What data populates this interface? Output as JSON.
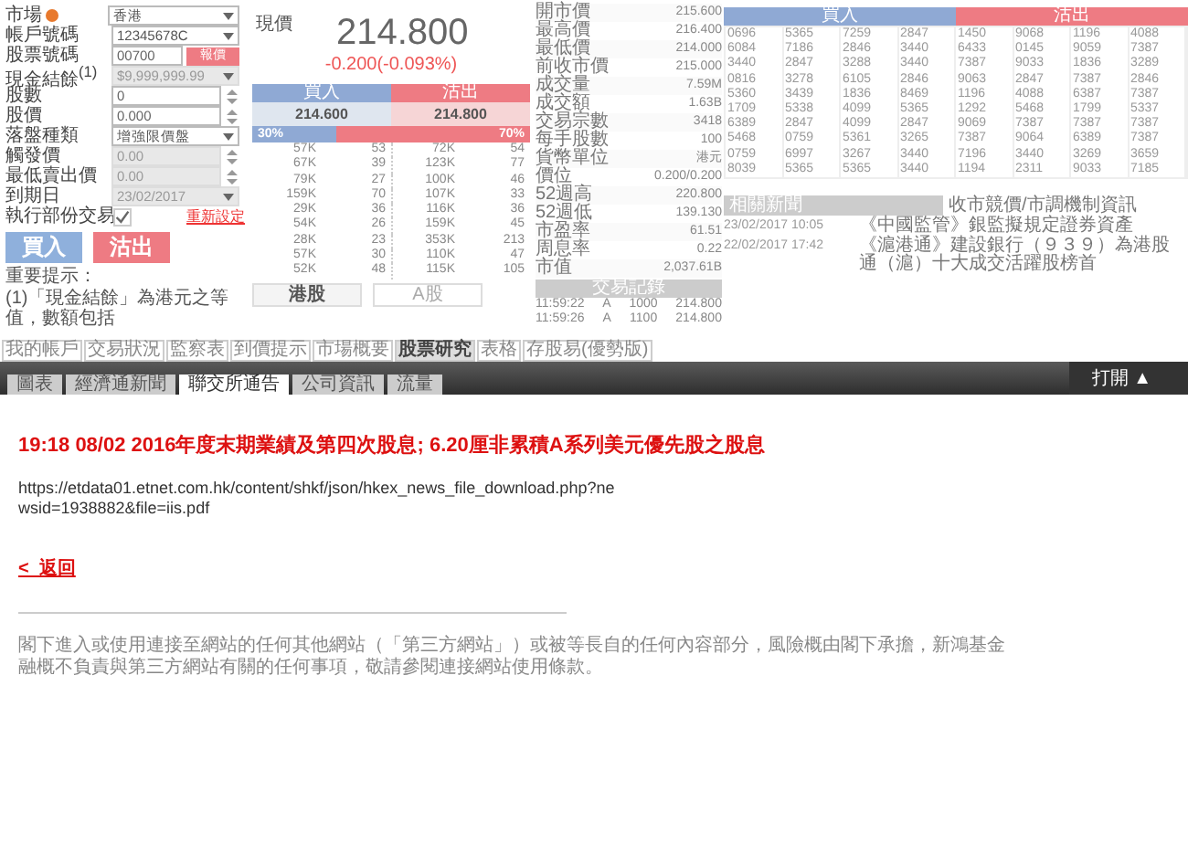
{
  "order_form": {
    "fields": [
      {
        "label": "市場",
        "kind": "select",
        "value": "香港",
        "disabled": false,
        "info": true
      },
      {
        "label": "帳戶號碼",
        "kind": "select",
        "value": "12345678C",
        "disabled": false,
        "info": false
      },
      {
        "label": "股票號碼",
        "kind": "quote",
        "value": "00700",
        "button": "報價",
        "disabled": false,
        "info": false
      },
      {
        "label": "現金結餘$^{(1)}$",
        "kind": "select",
        "value": "$9,999,999.99",
        "disabled": true,
        "info": false
      },
      {
        "label": "股數",
        "kind": "spinner",
        "value": "0",
        "disabled": false,
        "info": false
      },
      {
        "label": "股價",
        "kind": "spinner",
        "value": "0.000",
        "disabled": false,
        "info": false
      },
      {
        "label": "落盤種類",
        "kind": "select",
        "value": "增強限價盤",
        "disabled": false,
        "info": false
      },
      {
        "label": "觸發價",
        "kind": "spinner",
        "value": "0.00",
        "disabled": true,
        "info": false
      },
      {
        "label": "最低賣出價",
        "kind": "spinner",
        "value": "0.00",
        "disabled": true,
        "info": false
      },
      {
        "label": "到期日",
        "kind": "select",
        "value": "23/02/2017",
        "disabled": true,
        "info": false
      },
      {
        "label": "執行部份交易",
        "kind": "checkbox",
        "checked": true,
        "link": "重新設定",
        "disabled": false,
        "info": false
      }
    ],
    "buy_button": "買入",
    "sell_button": "沽出",
    "notice_title": "重要提示：",
    "notice": "(1)「現金結餘」為港元之等值，數額包括"
  },
  "quote": {
    "label": "現價",
    "price": "214.800",
    "change": "-0.200(-0.093%)",
    "bid_label": "買入",
    "ask_label": "沽出",
    "bid": "214.600",
    "ask": "214.800",
    "bid_share": "30%",
    "ask_share": "70%",
    "level": 0.3,
    "depth": [
      [
        "57K",
        "53",
        "72K",
        "54"
      ],
      [
        "67K",
        "39",
        "123K",
        "77"
      ],
      [
        "79K",
        "27",
        "100K",
        "46"
      ],
      [
        "159K",
        "70",
        "107K",
        "33"
      ],
      [
        "29K",
        "36",
        "116K",
        "36"
      ],
      [
        "54K",
        "26",
        "159K",
        "45"
      ],
      [
        "28K",
        "23",
        "353K",
        "213"
      ],
      [
        "57K",
        "30",
        "110K",
        "47"
      ],
      [
        "52K",
        "48",
        "115K",
        "105"
      ]
    ],
    "market_tabs": [
      {
        "label": "港股",
        "selected": true
      },
      {
        "label": "A股",
        "selected": false
      }
    ]
  },
  "stats": {
    "rows": [
      [
        "開市價",
        "215.600"
      ],
      [
        "最高價",
        "216.400"
      ],
      [
        "最低價",
        "214.000"
      ],
      [
        "前收市價",
        "215.000"
      ],
      [
        "成交量",
        "7.59M"
      ],
      [
        "成交額",
        "1.63B"
      ],
      [
        "交易宗數",
        "3418"
      ],
      [
        "每手股數",
        "100"
      ],
      [
        "貨幣單位",
        "港元"
      ],
      [
        "價位",
        "0.200/0.200"
      ],
      [
        "52週高",
        "220.800"
      ],
      [
        "52週低",
        "139.130"
      ],
      [
        "市盈率",
        "61.51"
      ],
      [
        "周息率",
        "0.22"
      ],
      [
        "市值",
        "2,037.61B"
      ]
    ],
    "trades_title": "交易記錄",
    "trades": [
      [
        "11:59:22",
        "A",
        "1000",
        "214.800"
      ],
      [
        "11:59:26",
        "A",
        "1100",
        "214.800"
      ]
    ]
  },
  "broker_queue": {
    "bid_label": "買入",
    "ask_label": "沽出",
    "rows": [
      [
        "0696",
        "5365",
        "7259",
        "2847",
        "1450",
        "9068",
        "1196",
        "4088"
      ],
      [
        "6084",
        "7186",
        "2846",
        "3440",
        "6433",
        "0145",
        "9059",
        "7387"
      ],
      [
        "3440",
        "2847",
        "3288",
        "3440",
        "7387",
        "9033",
        "1836",
        "3289"
      ],
      [
        "0816",
        "3278",
        "6105",
        "2846",
        "9063",
        "2847",
        "7387",
        "2846"
      ],
      [
        "5360",
        "3439",
        "1836",
        "8469",
        "1196",
        "4088",
        "6387",
        "7387"
      ],
      [
        "1709",
        "5338",
        "4099",
        "5365",
        "1292",
        "5468",
        "1799",
        "5337"
      ],
      [
        "6389",
        "2847",
        "4099",
        "2847",
        "9069",
        "7387",
        "7387",
        "7387"
      ],
      [
        "5468",
        "0759",
        "5361",
        "3265",
        "7387",
        "9064",
        "6389",
        "7387"
      ],
      [
        "0759",
        "6997",
        "3267",
        "3440",
        "7196",
        "3440",
        "3269",
        "3659"
      ],
      [
        "8039",
        "5365",
        "5365",
        "3440",
        "1194",
        "2311",
        "9033",
        "7185"
      ]
    ]
  },
  "news": {
    "tabs": [
      {
        "label": "相關新聞",
        "selected": true
      },
      {
        "label": "收市競價/市調機制資訊",
        "selected": false
      }
    ],
    "items": [
      {
        "time": "23/02/2017 10:05",
        "title": "《中國監管》銀監擬規定證券資產"
      },
      {
        "time": "22/02/2017 17:42",
        "title": "《滬港通》建設銀行（９３９）為港股通（滬）十大成交活躍股榜首"
      }
    ]
  },
  "main_tabs": [
    {
      "label": "我的帳戶",
      "selected": false
    },
    {
      "label": "交易狀況",
      "selected": false
    },
    {
      "label": "監察表",
      "selected": false
    },
    {
      "label": "到價提示",
      "selected": false
    },
    {
      "label": "市場概要",
      "selected": false
    },
    {
      "label": "股票研究",
      "selected": true
    },
    {
      "label": "表格",
      "selected": false
    },
    {
      "label": "存股易(優勢版)",
      "selected": false
    }
  ],
  "sub_tabs": [
    {
      "label": "圖表",
      "selected": false
    },
    {
      "label": "經濟通新聞",
      "selected": false
    },
    {
      "label": "聯交所通告",
      "selected": true
    },
    {
      "label": "公司資訊",
      "selected": false
    },
    {
      "label": "流量",
      "selected": false
    }
  ],
  "open_button": "打開 ▲",
  "article": {
    "title": "19:18 08/02 2016年度末期業績及第四次股息; 6.20厘非累積A系列美元優先股之股息",
    "url": "https://etdata01.etnet.com.hk/content/shkf/json/hkex_news_file_download.php?newsid=1938882&file=iis.pdf",
    "back_link": "<  返回",
    "disclaimer": "閣下進入或使用連接至網站的任何其他網站（「第三方網站」）或被等長自的任何內容部分，風險概由閣下承擔，新鴻基金融概不負責與第三方網站有關的任何事項，敬請參閱連接網站使用條款。"
  }
}
